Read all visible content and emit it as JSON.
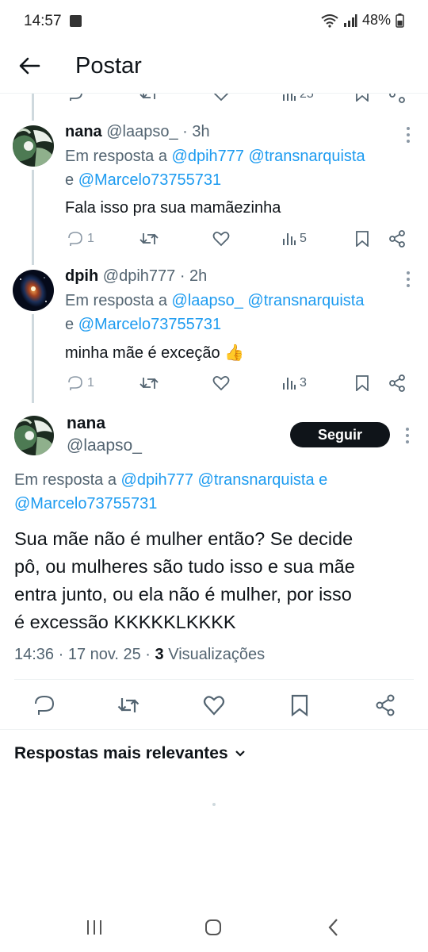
{
  "status_bar": {
    "time": "14:57",
    "battery": "48%"
  },
  "header": {
    "title": "Postar"
  },
  "partial_row": {
    "views": "25"
  },
  "replies": [
    {
      "name": "nana",
      "handle": "@laapso_ · 3h",
      "reply_prefix": "Em resposta a",
      "mentions_line1": "@dpih777 @transnarquista",
      "mentions_line2_prefix": "e",
      "mentions_line2": "@Marcelo73755731",
      "text": "Fala isso pra sua mamãezinha",
      "reply_count": "1",
      "view_count": "5"
    },
    {
      "name": "dpih",
      "handle": "@dpih777 · 2h",
      "reply_prefix": "Em resposta a",
      "mentions_line1": "@laapso_ @transnarquista",
      "mentions_line2_prefix": "e",
      "mentions_line2": "@Marcelo73755731",
      "text": "minha mãe é exceção",
      "emoji": "👍",
      "reply_count": "1",
      "view_count": "3"
    }
  ],
  "main_post": {
    "name": "nana",
    "handle": "@laapso_",
    "follow_label": "Seguir",
    "reply_prefix": "Em resposta a",
    "mentions_line1": "@dpih777 @transnarquista e",
    "mentions_line2": "@Marcelo73755731",
    "text_lines": [
      "Sua mãe não é mulher então? Se decide",
      "pô, ou mulheres são tudo isso e sua mãe",
      "entra junto, ou ela não é mulher, por isso",
      "é excessão KKKKKLKKKK"
    ],
    "timestamp": "14:36 · 17 nov. 25 ·",
    "views_count": "3",
    "views_label": "Visualizações"
  },
  "sort": {
    "label": "Respostas mais relevantes"
  },
  "colors": {
    "link": "#1d9bf0",
    "text": "#0f1419",
    "secondary": "#536471"
  },
  "icons": [
    "back-arrow-icon",
    "reply-icon",
    "retweet-icon",
    "like-icon",
    "views-icon",
    "bookmark-icon",
    "share-icon",
    "more-icon",
    "chevron-down-icon"
  ]
}
